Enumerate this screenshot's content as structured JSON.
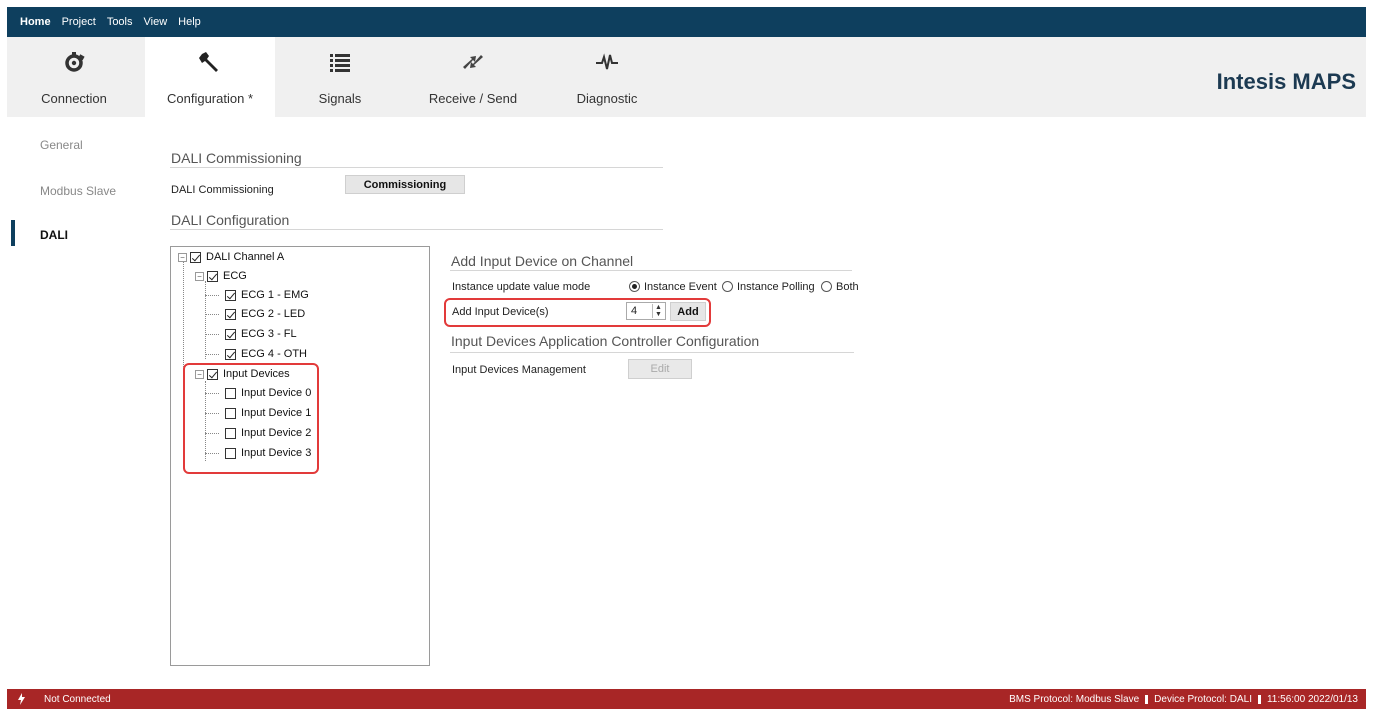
{
  "menu": [
    "Home",
    "Project",
    "Tools",
    "View",
    "Help"
  ],
  "brand": "Intesis MAPS",
  "ribbon": {
    "connection": "Connection",
    "configuration": "Configuration *",
    "signals": "Signals",
    "receive_send": "Receive / Send",
    "diagnostic": "Diagnostic"
  },
  "nav": {
    "general": "General",
    "modbus_slave": "Modbus Slave",
    "dali": "DALI"
  },
  "commissioning": {
    "section_title": "DALI Commissioning",
    "label": "DALI Commissioning",
    "button": "Commissioning"
  },
  "configuration": {
    "section_title": "DALI Configuration"
  },
  "tree": {
    "channel": "DALI Channel A",
    "ecg_group": "ECG",
    "ecg_items": [
      "ECG 1 - EMG",
      "ECG 2 - LED",
      "ECG 3 - FL",
      "ECG 4 - OTH"
    ],
    "input_group": "Input Devices",
    "input_items": [
      "Input Device 0",
      "Input Device 1",
      "Input Device 2",
      "Input Device 3"
    ]
  },
  "add_input": {
    "section_title": "Add Input Device on Channel",
    "mode_label": "Instance update value mode",
    "mode_options": [
      "Instance Event",
      "Instance Polling",
      "Both"
    ],
    "mode_selected": "Instance Event",
    "count_label": "Add Input Device(s)",
    "count_value": "4",
    "add_button": "Add"
  },
  "controller": {
    "section_title": "Input Devices Application Controller Configuration",
    "management_label": "Input Devices Management",
    "edit_button": "Edit"
  },
  "status": {
    "connection": "Not Connected",
    "bms": "BMS Protocol: Modbus Slave",
    "device": "Device Protocol: DALI",
    "datetime": "11:56:00 2022/01/13"
  }
}
